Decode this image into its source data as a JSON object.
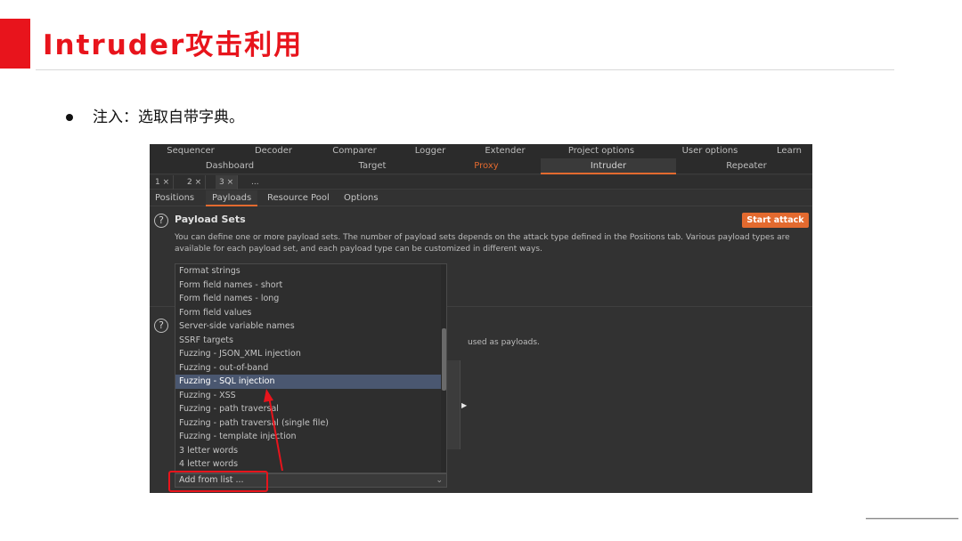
{
  "slide": {
    "title": "Intruder攻击利用",
    "bullet": "注入：选取自带字典。"
  },
  "burp": {
    "top_tabs_row1": [
      "Sequencer",
      "Decoder",
      "Comparer",
      "Logger",
      "Extender",
      "Project options",
      "User options",
      "Learn"
    ],
    "top_tabs_row2": [
      "Dashboard",
      "Target",
      "Proxy",
      "Intruder",
      "Repeater"
    ],
    "active_top_tab": "Intruder",
    "attack_tabs": [
      "1 ×",
      "2 ×",
      "3 ×",
      "..."
    ],
    "panel_tabs": [
      "Positions",
      "Payloads",
      "Resource Pool",
      "Options"
    ],
    "active_panel_tab": "Payloads",
    "help_icon": "question-circle-icon",
    "payload_sets_title": "Payload Sets",
    "start_attack_label": "Start attack",
    "payload_sets_description": "You can define one or more payload sets. The number of payload sets depends on the attack type defined in the Positions tab. Various payload types are available for each payload set, and each payload type can be customized in different ways.",
    "partial_text": "used as payloads.",
    "list_items": [
      "Format strings",
      "Form field names - short",
      "Form field names - long",
      "Form field values",
      "Server-side variable names",
      "SSRF targets",
      "Fuzzing - JSON_XML injection",
      "Fuzzing - out-of-band",
      "Fuzzing - SQL injection",
      "Fuzzing - XSS",
      "Fuzzing - path traversal",
      "Fuzzing - path traversal (single file)",
      "Fuzzing - template injection",
      "3 letter words",
      "4 letter words"
    ],
    "selected_item": "Fuzzing - SQL injection",
    "combo_label": "Add from list ...",
    "combo_icon": "chevron-down-icon",
    "accent_color": "#e36a2f",
    "annotation_color": "#e8141c"
  }
}
